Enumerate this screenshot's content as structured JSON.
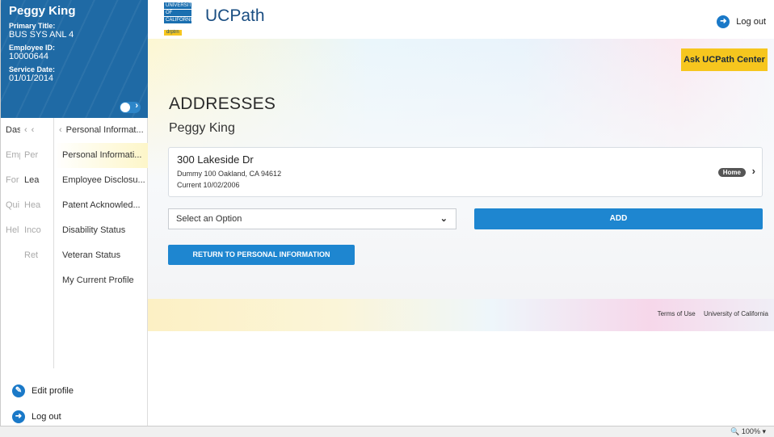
{
  "profile": {
    "name": "Peggy King",
    "primary_title_label": "Primary Title:",
    "primary_title": "BUS SYS ANL 4",
    "employee_id_label": "Employee ID:",
    "employee_id": "10000644",
    "service_date_label": "Service Date:",
    "service_date": "01/01/2014"
  },
  "nav": {
    "col1": [
      "Das",
      "Emp",
      "For",
      "Qui",
      "Hel"
    ],
    "col2": [
      "Per",
      "Lea",
      "Hea",
      "Inco",
      "Ret"
    ],
    "col3_header": "Personal Informat...",
    "col3": [
      "Personal Informati...",
      "Employee Disclosu...",
      "Patent Acknowled...",
      "Disability Status",
      "Veteran Status",
      "My Current Profile"
    ]
  },
  "sidebar_footer": {
    "edit_profile": "Edit profile",
    "log_out": "Log out"
  },
  "header": {
    "logo_lines": [
      "UNIVERSITY",
      "OF",
      "CALIFORNIA"
    ],
    "logo_tag": "drptrn",
    "brand": "UCPath",
    "log_out": "Log out",
    "ask_button": "Ask UCPath Center"
  },
  "main": {
    "title": "ADDRESSES",
    "person_name": "Peggy King",
    "address": {
      "street": "300 Lakeside Dr",
      "city_line": "Dummy 100 Oakland, CA 94612",
      "status_line": "Current 10/02/2006",
      "badge": "Home"
    },
    "select_value": "Select an Option",
    "add_button": "ADD",
    "return_button": "RETURN TO PERSONAL INFORMATION"
  },
  "footer": {
    "terms": "Terms of Use",
    "university": "University of California"
  },
  "statusbar": {
    "zoom": "100%"
  },
  "colors": {
    "sidebar_blue": "#1f6aa5",
    "accent_blue": "#1e86d0",
    "ask_yellow": "#f6c61e"
  }
}
